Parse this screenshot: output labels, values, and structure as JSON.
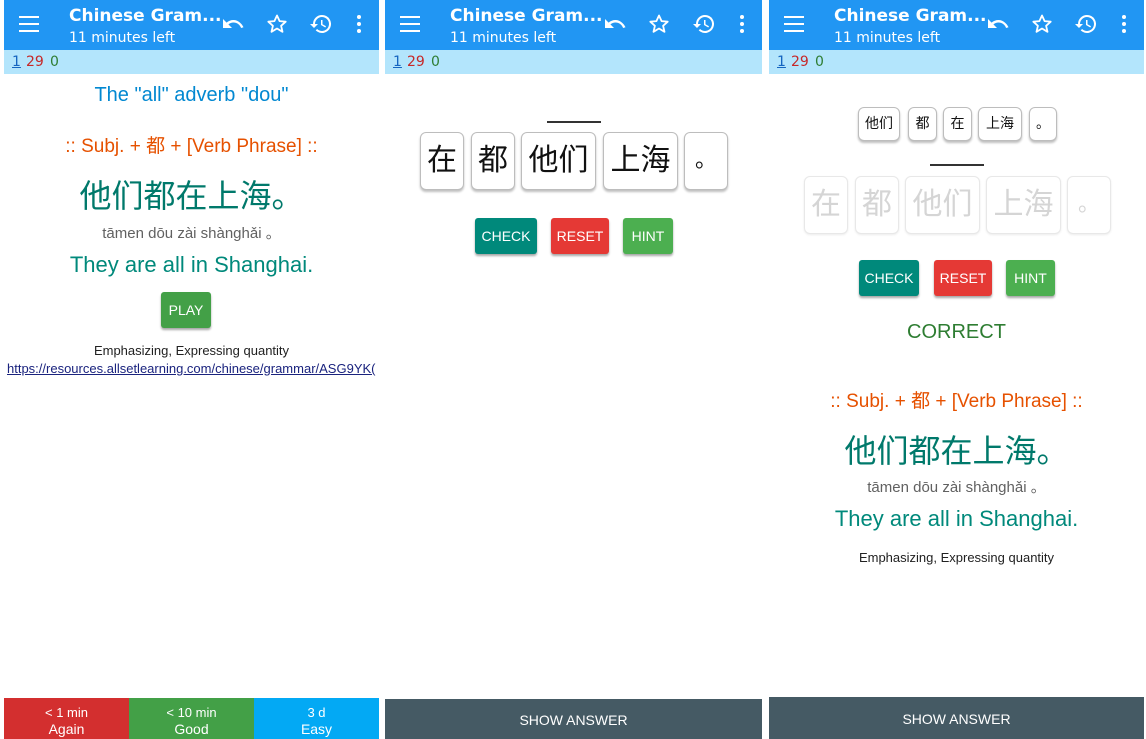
{
  "toolbar": {
    "title": "Chinese Gram...",
    "subtitle": "11 minutes left"
  },
  "counts": {
    "new": "1",
    "learning": "29",
    "review": "0"
  },
  "icons": [
    "menu-icon",
    "undo-icon",
    "star-icon",
    "history-icon",
    "more-vert-icon"
  ],
  "colors": {
    "toolbar": "#2196f3",
    "countbar": "#b3e5fc",
    "again": "#d32f2f",
    "good": "#43a047",
    "easy": "#03a9f4"
  },
  "card": {
    "heading": "The \"all\" adverb \"dou\"",
    "pattern": ":: Subj. + 都 + [Verb Phrase] ::",
    "hanzi": "他们都在上海。",
    "pinyin": "tāmen dōu zài shànghǎi 。",
    "english": "They are all in Shanghai.",
    "play": "PLAY",
    "tags": "Emphasizing, Expressing quantity",
    "link": "https://resources.allsetlearning.com/chinese/grammar/ASG9YK("
  },
  "answers": [
    {
      "time": "< 1 min",
      "label": "Again"
    },
    {
      "time": "< 10 min",
      "label": "Good"
    },
    {
      "time": "3 d",
      "label": "Easy"
    }
  ],
  "puzzle": {
    "tiles": [
      "在",
      "都",
      "他们",
      "上海",
      "。"
    ],
    "placed": [
      "他们",
      "都",
      "在",
      "上海",
      "。"
    ],
    "check": "CHECK",
    "reset": "RESET",
    "hint": "HINT",
    "result": "CORRECT"
  },
  "show_answer": "SHOW ANSWER"
}
